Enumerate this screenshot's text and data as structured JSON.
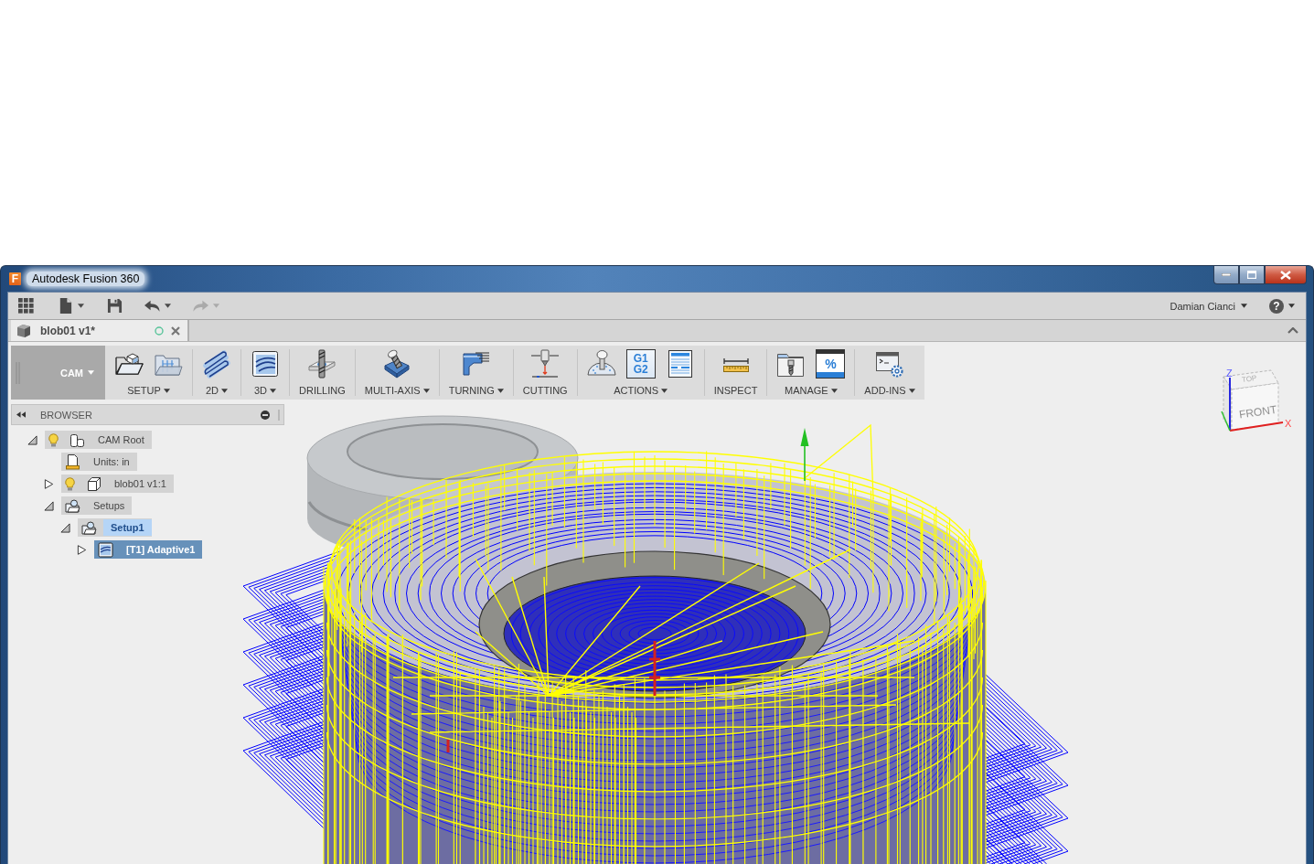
{
  "window": {
    "logo": "F",
    "title": "Autodesk Fusion 360"
  },
  "toolbar": {
    "buttons": [
      {
        "kind": "grid",
        "dropdown": false,
        "disabled": false
      },
      {
        "kind": "file",
        "dropdown": true,
        "disabled": false
      },
      {
        "kind": "save",
        "dropdown": false,
        "disabled": false
      },
      {
        "kind": "undo",
        "dropdown": true,
        "disabled": false
      },
      {
        "kind": "redo",
        "dropdown": true,
        "disabled": true
      }
    ],
    "user": "Damian Cianci",
    "help": "?"
  },
  "tabs": [
    {
      "title": "blob01 v1*",
      "selected": true
    }
  ],
  "workspace": {
    "label": "CAM"
  },
  "ribbon": [
    {
      "label": "SETUP",
      "dropdown": true,
      "tools": [
        {
          "kind": "setup"
        },
        {
          "kind": "template"
        }
      ]
    },
    {
      "label": "2D",
      "dropdown": true,
      "tools": [
        {
          "kind": "pocket"
        }
      ]
    },
    {
      "label": "3D",
      "dropdown": true,
      "tools": [
        {
          "kind": "surface"
        }
      ]
    },
    {
      "label": "DRILLING",
      "dropdown": false,
      "tools": [
        {
          "kind": "drilling"
        }
      ]
    },
    {
      "label": "MULTI-AXIS",
      "dropdown": true,
      "tools": [
        {
          "kind": "multiaxis"
        }
      ]
    },
    {
      "label": "TURNING",
      "dropdown": true,
      "tools": [
        {
          "kind": "turning"
        }
      ]
    },
    {
      "label": "CUTTING",
      "dropdown": false,
      "tools": [
        {
          "kind": "cutting"
        }
      ]
    },
    {
      "label": "ACTIONS",
      "dropdown": true,
      "tools": [
        {
          "kind": "simulate"
        },
        {
          "kind": "post",
          "text": "G1 G2"
        },
        {
          "kind": "sheet"
        }
      ]
    },
    {
      "label": "INSPECT",
      "dropdown": false,
      "tools": [
        {
          "kind": "measure"
        }
      ]
    },
    {
      "label": "MANAGE",
      "dropdown": true,
      "tools": [
        {
          "kind": "library"
        },
        {
          "kind": "postlibrary",
          "text": "%"
        }
      ]
    },
    {
      "label": "ADD-INS",
      "dropdown": true,
      "tools": [
        {
          "kind": "addins"
        }
      ]
    }
  ],
  "browser": {
    "title": "BROWSER",
    "tree": [
      {
        "label": "CAM Root",
        "kind": "root",
        "expanded": true,
        "visible": true,
        "selected": false,
        "active": false,
        "children": [
          {
            "label": "Units: in",
            "kind": "units",
            "selected": false,
            "active": false
          },
          {
            "label": "blob01 v1:1",
            "kind": "body",
            "expanded": false,
            "visible": true,
            "selected": false,
            "active": false
          },
          {
            "label": "Setups",
            "kind": "setups",
            "expanded": true,
            "selected": false,
            "active": false,
            "children": [
              {
                "label": "Setup1",
                "kind": "setup",
                "expanded": true,
                "selected": false,
                "active": true,
                "children": [
                  {
                    "label": "[T1] Adaptive1",
                    "kind": "operation",
                    "expanded": false,
                    "selected": true,
                    "active": false
                  }
                ]
              }
            ]
          }
        ]
      }
    ]
  },
  "view_cube": {
    "top": "TOP",
    "front": "FRONT",
    "z_axis": "Z",
    "x_axis": "X"
  }
}
